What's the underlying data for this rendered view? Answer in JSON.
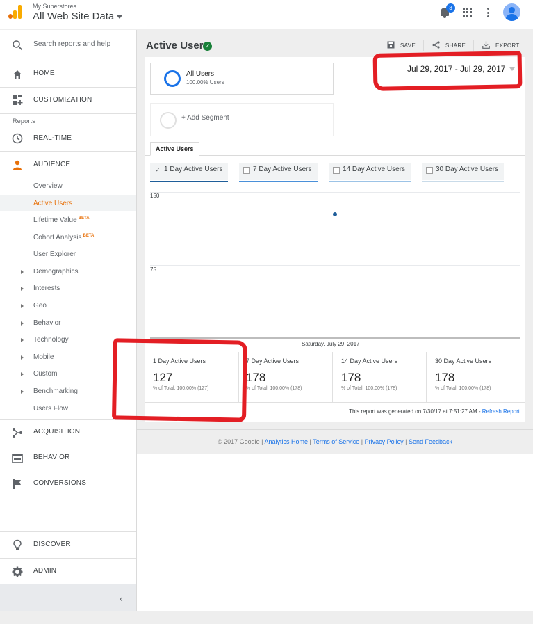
{
  "topbar": {
    "account_small": "My Superstores",
    "account_big": "All Web Site Data",
    "notification_count": "3"
  },
  "sidebar": {
    "search": "Search reports and help",
    "home": "HOME",
    "customization": "CUSTOMIZATION",
    "reports_header": "Reports",
    "realtime": "REAL-TIME",
    "audience": "AUDIENCE",
    "audience_items": [
      {
        "label": "Overview"
      },
      {
        "label": "Active Users"
      },
      {
        "label": "Lifetime Value",
        "badge": "BETA"
      },
      {
        "label": "Cohort Analysis",
        "badge": "BETA"
      },
      {
        "label": "User Explorer"
      },
      {
        "label": "Demographics"
      },
      {
        "label": "Interests"
      },
      {
        "label": "Geo"
      },
      {
        "label": "Behavior"
      },
      {
        "label": "Technology"
      },
      {
        "label": "Mobile"
      },
      {
        "label": "Custom"
      },
      {
        "label": "Benchmarking"
      },
      {
        "label": "Users Flow"
      }
    ],
    "acquisition": "ACQUISITION",
    "behavior": "BEHAVIOR",
    "conversions": "CONVERSIONS",
    "discover": "DISCOVER",
    "admin": "ADMIN",
    "collapse_glyph": "‹"
  },
  "header": {
    "title": "Active Users",
    "save": "SAVE",
    "share": "SHARE",
    "export": "EXPORT"
  },
  "segment": {
    "name": "All Users",
    "sub": "100.00% Users",
    "add": "+ Add Segment"
  },
  "date_range": "Jul 29, 2017 - Jul 29, 2017",
  "tab": "Active Users",
  "metrics": [
    {
      "label": "1 Day Active Users",
      "checked": "✓",
      "color": "#1f5e9a"
    },
    {
      "label": "7 Day Active Users",
      "checked": "",
      "color": "#4a90d9"
    },
    {
      "label": "14 Day Active Users",
      "checked": "",
      "color": "#9cc3e6"
    },
    {
      "label": "30 Day Active Users",
      "checked": "",
      "color": "#c9dbe9"
    }
  ],
  "chart_data": {
    "type": "scatter",
    "x": [
      "Saturday, July 29, 2017"
    ],
    "series": [
      {
        "values": [
          127
        ]
      }
    ],
    "yticks": [
      150,
      75
    ],
    "ylim": [
      0,
      150
    ],
    "grid": true
  },
  "stats": [
    {
      "name": "1 Day Active Users",
      "value": "127",
      "total": "% of Total: 100.00% (127)"
    },
    {
      "name": "7 Day Active Users",
      "value": "178",
      "total": "% of Total: 100.00% (178)"
    },
    {
      "name": "14 Day Active Users",
      "value": "178",
      "total": "% of Total: 100.00% (178)"
    },
    {
      "name": "30 Day Active Users",
      "value": "178",
      "total": "% of Total: 100.00% (178)"
    }
  ],
  "generated": {
    "text": "This report was generated on 7/30/17 at 7:51:27 AM - ",
    "link": "Refresh Report"
  },
  "footer": {
    "copyright": "© 2017 Google | ",
    "links": [
      "Analytics Home",
      "Terms of Service",
      "Privacy Policy",
      "Send Feedback"
    ],
    "separator": " | "
  }
}
